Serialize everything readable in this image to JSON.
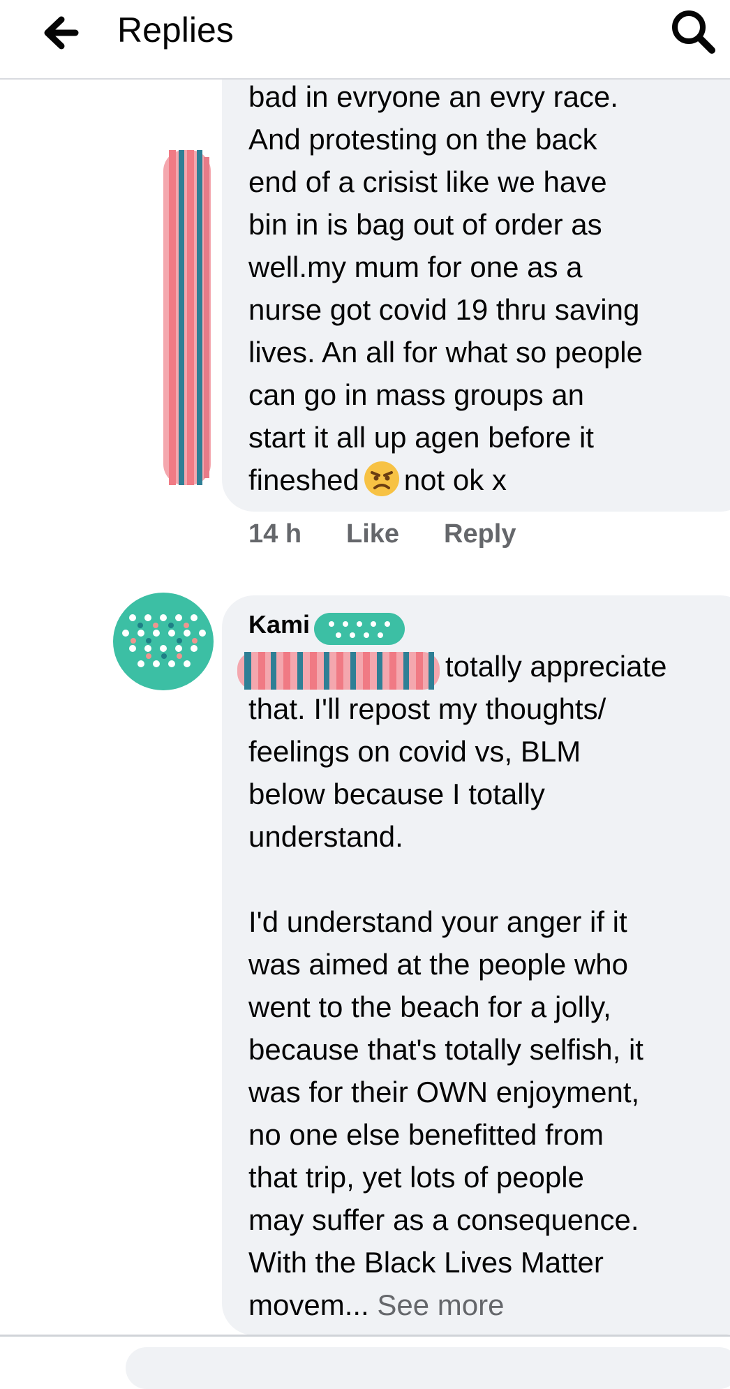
{
  "header": {
    "title": "Replies",
    "back_icon": "arrow-left-icon",
    "search_icon": "search-icon"
  },
  "comment1": {
    "text": "bad in evryone an evry race.\nAnd protesting on the back\nend of a crisist like we have\nbin in is bag out of order as\nwell.my mum for one as a\nnurse got covid 19 thru saving\nlives. An all for what so people\ncan go in mass groups an\nstart it all up agen before it\n",
    "last_line_start": "fineshed",
    "last_line_end": "not ok x",
    "emoji": "angry-face-emoji",
    "time": "14 h",
    "like_label": "Like",
    "reply_label": "Reply"
  },
  "comment2": {
    "author": "Kami",
    "first_line": "totally appreciate",
    "text": "that. I'll repost my thoughts/\nfeelings on covid vs, BLM\nbelow because I totally\nunderstand.\n\nI'd understand your anger if it\nwas aimed at the people who\nwent to the beach for a jolly,\nbecause that's totally selfish, it\nwas for their OWN enjoyment,\nno one else benefitted from\nthat trip, yet lots of people\nmay suffer as a consequence.\nWith the Black Lives Matter\n",
    "last_line": "movem... ",
    "see_more_label": "See more"
  },
  "colors": {
    "bubble": "#f0f2f5",
    "meta_text": "#65676b",
    "redact_pink": "#f07a84",
    "redact_teal": "#2f7f95",
    "avatar_green": "#3cbfa4"
  }
}
